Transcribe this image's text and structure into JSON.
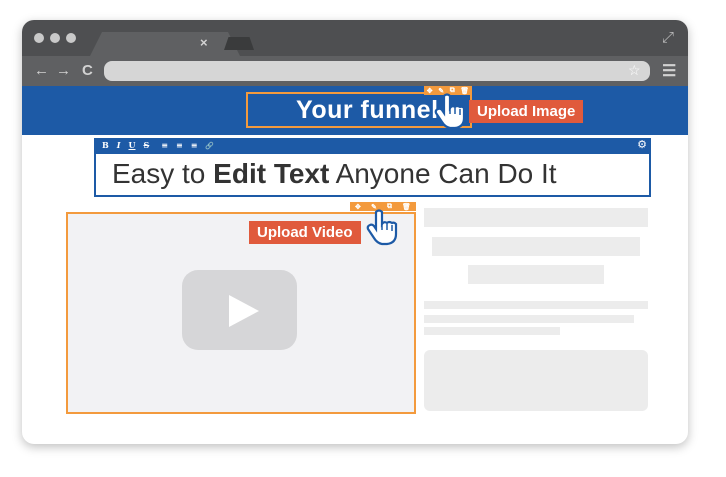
{
  "browser": {
    "window_controls": [
      "close-dot",
      "minimize-dot",
      "maximize-dot"
    ],
    "tab_close_glyph": "×",
    "nav": {
      "back_glyph": "←",
      "forward_glyph": "→",
      "reload_glyph": "C",
      "star_glyph": "☆",
      "menu_glyph": "☰",
      "expand_glyph": "⤢"
    }
  },
  "header": {
    "funnel_title": "Your funnel",
    "upload_image_label": "Upload Image"
  },
  "editor": {
    "toolbar": {
      "bold": "B",
      "italic": "I",
      "underline": "U",
      "strike": "S",
      "align_left": "≡",
      "align_center": "≡",
      "align_right": "≡",
      "link": "🔗",
      "settings": "⚙"
    },
    "headline_part1": "Easy to ",
    "headline_bold": "Edit Text",
    "headline_part2": " Anyone Can Do It"
  },
  "video": {
    "upload_video_label": "Upload Video"
  },
  "mini_toolbar": {
    "move": "✥",
    "edit": "✎",
    "copy": "⧉",
    "delete": "🗑"
  },
  "colors": {
    "header_blue": "#1d5aa6",
    "accent_orange": "#f39a3d",
    "upload_red": "#e05a3c",
    "chrome_dark": "#4e4f51"
  }
}
